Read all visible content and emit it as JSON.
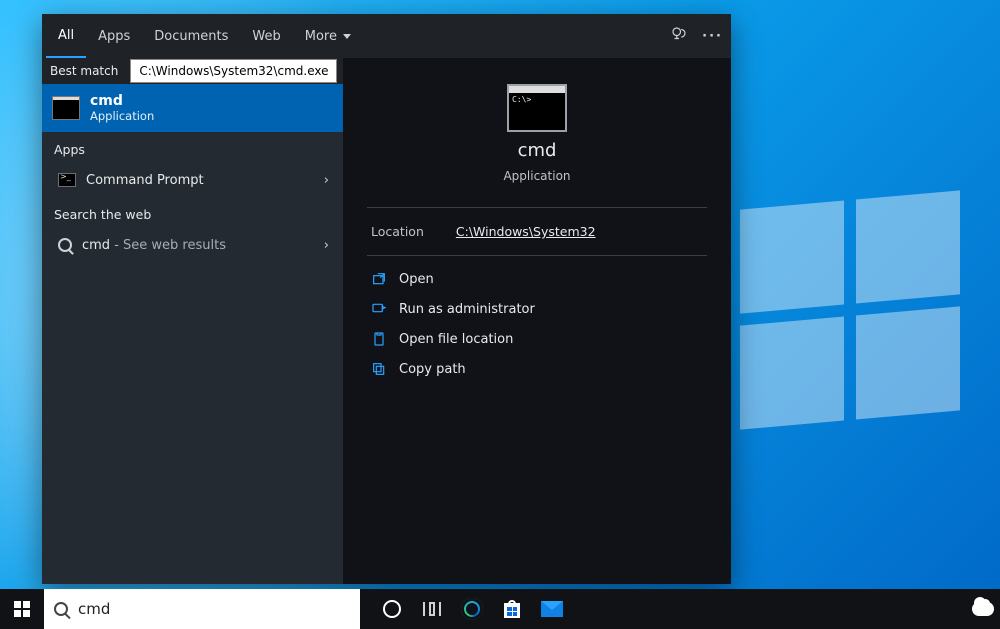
{
  "tabs": {
    "all": "All",
    "apps": "Apps",
    "documents": "Documents",
    "web": "Web",
    "more": "More"
  },
  "best_match_label": "Best match",
  "tooltip_path": "C:\\Windows\\System32\\cmd.exe",
  "result": {
    "title": "cmd",
    "subtitle": "Application"
  },
  "sections": {
    "apps": "Apps",
    "apps_item": "Command Prompt",
    "web": "Search the web",
    "web_item_prefix": "cmd",
    "web_item_suffix": " - See web results"
  },
  "preview": {
    "title": "cmd",
    "subtitle": "Application",
    "location_label": "Location",
    "location_value": "C:\\Windows\\System32",
    "actions": {
      "open": "Open",
      "run_admin": "Run as administrator",
      "open_loc": "Open file location",
      "copy_path": "Copy path"
    }
  },
  "search_input_value": "cmd"
}
